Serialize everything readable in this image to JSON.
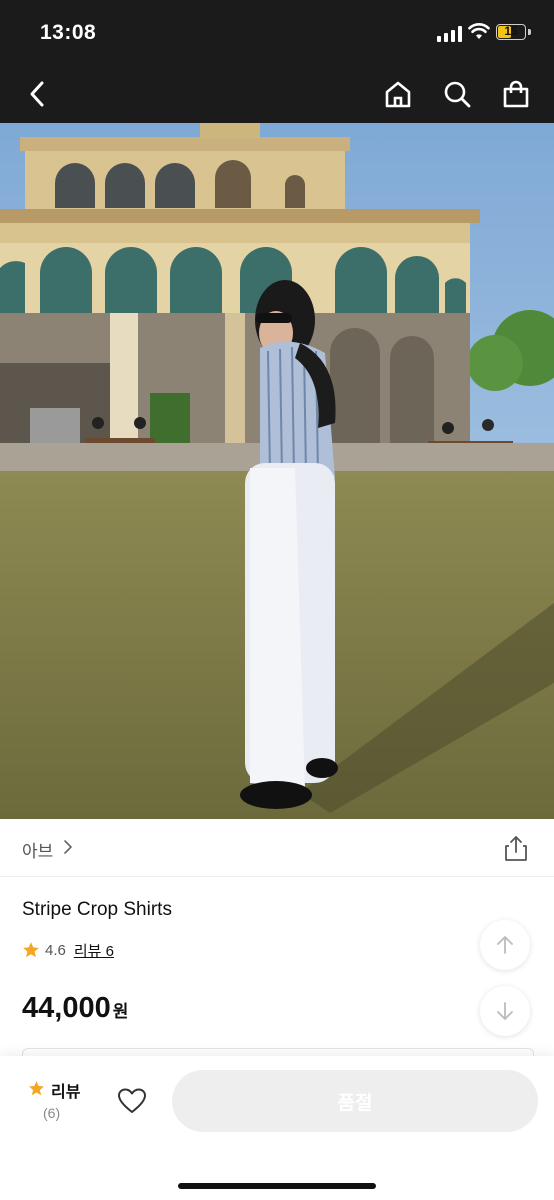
{
  "status_bar": {
    "time": "13:08",
    "battery": "15"
  },
  "nav": {
    "back_icon": "chevron-left-icon",
    "home_icon": "home-icon",
    "search_icon": "search-icon",
    "bag_icon": "shopping-bag-icon"
  },
  "product": {
    "brand": "아브",
    "title": "Stripe Crop Shirts",
    "rating": "4.6",
    "review_link": "리뷰 6",
    "price": "44,000",
    "currency": "원"
  },
  "bottom_bar": {
    "review_label": "리뷰",
    "review_count": "(6)",
    "soldout_label": "품절"
  },
  "colors": {
    "accent_star": "#f5a623",
    "soldout_bg": "#eeeeee",
    "header_bg": "#1b1b1b"
  }
}
